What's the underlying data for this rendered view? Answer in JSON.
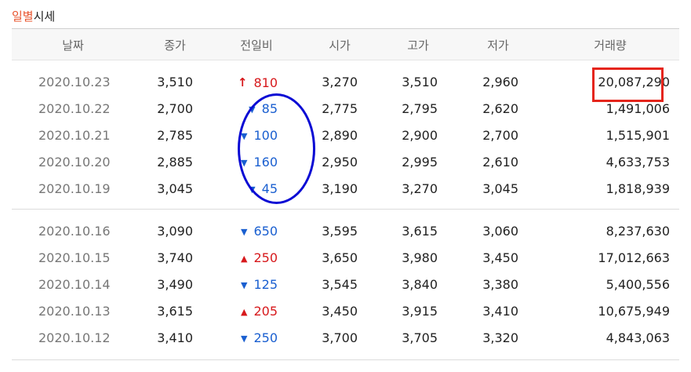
{
  "section": {
    "title_accent": "일별",
    "title_rest": "시세"
  },
  "header": [
    "날짜",
    "종가",
    "전일비",
    "시가",
    "고가",
    "저가",
    "거래량"
  ],
  "rows_group1": [
    {
      "date": "2020.10.23",
      "close": "3,510",
      "dir": "up-arrow",
      "change": "810",
      "open": "3,270",
      "high": "3,510",
      "low": "2,960",
      "volume": "20,087,290"
    },
    {
      "date": "2020.10.22",
      "close": "2,700",
      "dir": "down",
      "change": "85",
      "open": "2,775",
      "high": "2,795",
      "low": "2,620",
      "volume": "1,491,006"
    },
    {
      "date": "2020.10.21",
      "close": "2,785",
      "dir": "down",
      "change": "100",
      "open": "2,890",
      "high": "2,900",
      "low": "2,700",
      "volume": "1,515,901"
    },
    {
      "date": "2020.10.20",
      "close": "2,885",
      "dir": "down",
      "change": "160",
      "open": "2,950",
      "high": "2,995",
      "low": "2,610",
      "volume": "4,633,753"
    },
    {
      "date": "2020.10.19",
      "close": "3,045",
      "dir": "down",
      "change": "45",
      "open": "3,190",
      "high": "3,270",
      "low": "3,045",
      "volume": "1,818,939"
    }
  ],
  "rows_group2": [
    {
      "date": "2020.10.16",
      "close": "3,090",
      "dir": "down",
      "change": "650",
      "open": "3,595",
      "high": "3,615",
      "low": "3,060",
      "volume": "8,237,630"
    },
    {
      "date": "2020.10.15",
      "close": "3,740",
      "dir": "up",
      "change": "250",
      "open": "3,650",
      "high": "3,980",
      "low": "3,450",
      "volume": "17,012,663"
    },
    {
      "date": "2020.10.14",
      "close": "3,490",
      "dir": "down",
      "change": "125",
      "open": "3,545",
      "high": "3,840",
      "low": "3,380",
      "volume": "5,400,556"
    },
    {
      "date": "2020.10.13",
      "close": "3,615",
      "dir": "up",
      "change": "205",
      "open": "3,450",
      "high": "3,915",
      "low": "3,410",
      "volume": "10,675,949"
    },
    {
      "date": "2020.10.12",
      "close": "3,410",
      "dir": "down",
      "change": "250",
      "open": "3,700",
      "high": "3,705",
      "low": "3,320",
      "volume": "4,843,063"
    }
  ],
  "colors": {
    "accent": "#e8542e",
    "up": "#d7191c",
    "down": "#1a5fd0",
    "highlight_box": "#e5251c",
    "highlight_oval": "#0a0ad4"
  }
}
